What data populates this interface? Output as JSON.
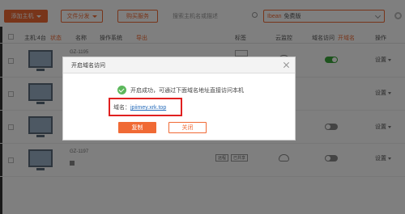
{
  "toolbar": {
    "add_host": "添加主机",
    "batch_op": "文件分发",
    "buy_service": "购买服务",
    "search_placeholder": "搜索主机名或描述",
    "domain_tag": "Ibean",
    "domain_value": "免费版"
  },
  "table_header": {
    "host": "主机:4台",
    "status": "状态",
    "name": "名称",
    "os": "操作系统",
    "export": "导出",
    "tags": "标签",
    "cloud": "云监控",
    "domain_access": "域名访问",
    "open_domain": "开域名",
    "actions": "操作"
  },
  "rows": [
    {
      "name": "GZ-1195",
      "toggle": "on",
      "settings": "设置"
    },
    {
      "name": "",
      "toggle": "none",
      "settings": "设置"
    },
    {
      "name": "",
      "toggle": "off",
      "settings": "设置"
    },
    {
      "name": "GZ-1197",
      "toggle": "off",
      "settings": "设置",
      "btn1": "远程",
      "btn2": "已共享"
    }
  ],
  "dialog": {
    "title": "开启域名访问",
    "success_message": "开启成功，可通过下面域名地址直接访问本机",
    "domain_label": "域名：",
    "domain_value": "jpiimey.xrk.top",
    "copy_button": "复制",
    "close_button": "关闭"
  },
  "colors": {
    "accent": "#f06a35",
    "highlight": "#e02020",
    "success": "#5cb85c",
    "link": "#2a6ebb"
  }
}
